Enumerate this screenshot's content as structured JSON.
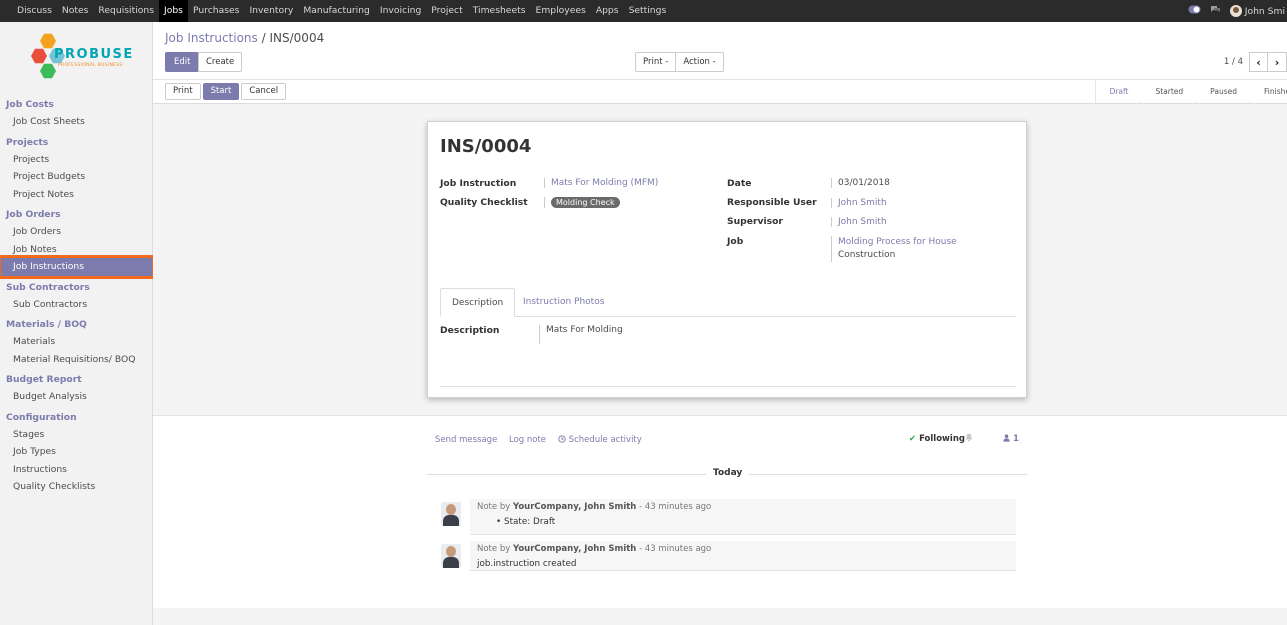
{
  "topnav": {
    "items": [
      "Discuss",
      "Notes",
      "Requisitions",
      "Jobs",
      "Purchases",
      "Inventory",
      "Manufacturing",
      "Invoicing",
      "Project",
      "Timesheets",
      "Employees",
      "Apps",
      "Settings"
    ],
    "active": "Jobs",
    "user_name": "John Smi"
  },
  "logo": {
    "word": "PROBUSE",
    "tagline": "PROFESSIONAL BUSINESS"
  },
  "sidebar": {
    "sections": [
      {
        "title": "Job Costs",
        "items": [
          "Job Cost Sheets"
        ]
      },
      {
        "title": "Projects",
        "items": [
          "Projects",
          "Project Budgets",
          "Project Notes"
        ]
      },
      {
        "title": "Job Orders",
        "items": [
          "Job Orders",
          "Job Notes",
          "Job Instructions"
        ]
      },
      {
        "title": "Sub Contractors",
        "items": [
          "Sub Contractors"
        ]
      },
      {
        "title": "Materials / BOQ",
        "items": [
          "Materials",
          "Material Requisitions/ BOQ"
        ]
      },
      {
        "title": "Budget Report",
        "items": [
          "Budget Analysis"
        ]
      },
      {
        "title": "Configuration",
        "items": [
          "Stages",
          "Job Types",
          "Instructions",
          "Quality Checklists"
        ]
      }
    ],
    "active_item": "Job Instructions"
  },
  "control_panel": {
    "breadcrumb_parent": "Job Instructions",
    "breadcrumb_sep": "/",
    "breadcrumb_current": "INS/0004",
    "edit_label": "Edit",
    "create_label": "Create",
    "print_label": "Print -",
    "action_label": "Action -",
    "pager": "1 / 4",
    "prev_glyph": "‹",
    "next_glyph": "›"
  },
  "statusbar": {
    "print_label": "Print",
    "start_label": "Start",
    "cancel_label": "Cancel",
    "stages": [
      "Draft",
      "Started",
      "Paused",
      "Finished"
    ],
    "current_stage": "Draft"
  },
  "form": {
    "title": "INS/0004",
    "job_instruction_label": "Job Instruction",
    "job_instruction_value": "Mats For Molding (MFM)",
    "quality_checklist_label": "Quality Checklist",
    "quality_checklist_tag": "Molding Check",
    "date_label": "Date",
    "date_value": "03/01/2018",
    "responsible_user_label": "Responsible User",
    "responsible_user_value": "John Smith",
    "supervisor_label": "Supervisor",
    "supervisor_value": "John Smith",
    "job_label": "Job",
    "job_value_line1": "Molding Process for House",
    "job_value_line2": "Construction",
    "tabs": [
      "Description",
      "Instruction Photos"
    ],
    "description_label": "Description",
    "description_value": "Mats For Molding"
  },
  "chatter": {
    "send_message": "Send message",
    "log_note": "Log note",
    "schedule_activity": "Schedule activity",
    "following": "Following",
    "followers_count": "1",
    "today": "Today",
    "messages": [
      {
        "prefix": "Note by",
        "author": "YourCompany, John Smith",
        "time": "- 43 minutes ago",
        "body": "State: Draft"
      },
      {
        "prefix": "Note by",
        "author": "YourCompany, John Smith",
        "time": "- 43 minutes ago",
        "body": "job.instruction created"
      }
    ]
  }
}
